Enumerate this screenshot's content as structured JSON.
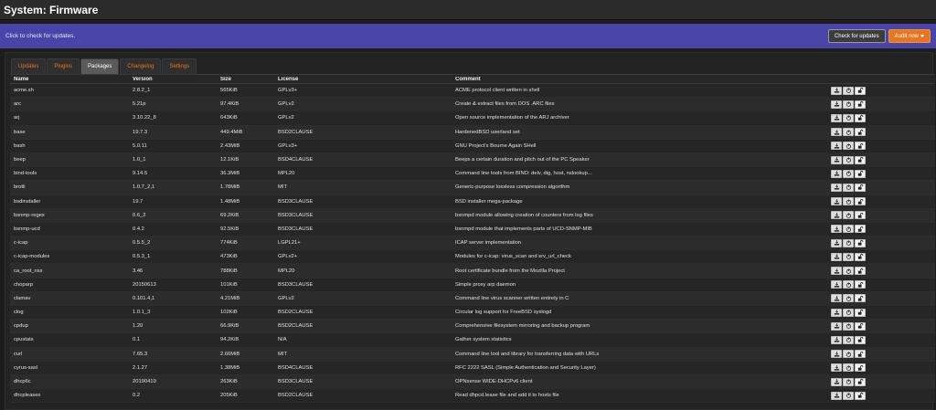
{
  "header": {
    "title": "System: Firmware"
  },
  "banner": {
    "message": "Click to check for updates.",
    "check_label": "Check for updates",
    "audit_label": "Audit now"
  },
  "tabs": [
    {
      "label": "Updates",
      "active": false
    },
    {
      "label": "Plugins",
      "active": false
    },
    {
      "label": "Packages",
      "active": true
    },
    {
      "label": "Changelog",
      "active": false
    },
    {
      "label": "Settings",
      "active": false
    }
  ],
  "table": {
    "columns": [
      "Name",
      "Version",
      "Size",
      "License",
      "Comment"
    ],
    "rows": [
      {
        "name": "acme.sh",
        "version": "2.8.2_1",
        "size": "565KiB",
        "license": "GPLv3+",
        "comment": "ACME protocol client written in shell"
      },
      {
        "name": "arc",
        "version": "5.21p",
        "size": "97.4KiB",
        "license": "GPLv2",
        "comment": "Create & extract files from DOS .ARC files"
      },
      {
        "name": "arj",
        "version": "3.10.22_8",
        "size": "643KiB",
        "license": "GPLv2",
        "comment": "Open source implementation of the ARJ archiver"
      },
      {
        "name": "base",
        "version": "19.7.3",
        "size": "449.4MiB",
        "license": "BSD2CLAUSE",
        "comment": "HardenedBSD userland set"
      },
      {
        "name": "bash",
        "version": "5.0.11",
        "size": "2.43MiB",
        "license": "GPLv3+",
        "comment": "GNU Project's Bourne Again SHell"
      },
      {
        "name": "beep",
        "version": "1.0_1",
        "size": "12.1KiB",
        "license": "BSD4CLAUSE",
        "comment": "Beeps a certain duration and pitch out of the PC Speaker"
      },
      {
        "name": "bind-tools",
        "version": "9.14.5",
        "size": "36.3MiB",
        "license": "MPL20",
        "comment": "Command line tools from BIND: delv, dig, host, nslookup..."
      },
      {
        "name": "brotli",
        "version": "1.0.7_2,1",
        "size": "1.78MiB",
        "license": "MIT",
        "comment": "Generic-purpose lossless compression algorithm"
      },
      {
        "name": "bsdinstaller",
        "version": "19.7",
        "size": "1.48MiB",
        "license": "BSD3CLAUSE",
        "comment": "BSD installer mega-package"
      },
      {
        "name": "bsnmp-regex",
        "version": "0.6_2",
        "size": "69.2KiB",
        "license": "BSD3CLAUSE",
        "comment": "bsnmpd module allowing creation of counters from log files"
      },
      {
        "name": "bsnmp-ucd",
        "version": "0.4.2",
        "size": "92.5KiB",
        "license": "BSD3CLAUSE",
        "comment": "bsnmpd module that implements parts of UCD-SNMP-MIB"
      },
      {
        "name": "c-icap",
        "version": "0.5.5_2",
        "size": "774KiB",
        "license": "LGPL21+",
        "comment": "ICAP server implementation"
      },
      {
        "name": "c-icap-modules",
        "version": "0.5.3_1",
        "size": "473KiB",
        "license": "GPLv2+",
        "comment": "Modules for c-icap: virus_scan and srv_url_check"
      },
      {
        "name": "ca_root_nss",
        "version": "3.46",
        "size": "788KiB",
        "license": "MPL20",
        "comment": "Root certificate bundle from the Mozilla Project"
      },
      {
        "name": "choparp",
        "version": "20150613",
        "size": "101KiB",
        "license": "BSD3CLAUSE",
        "comment": "Simple proxy arp daemon"
      },
      {
        "name": "clamav",
        "version": "0.101.4,1",
        "size": "4.21MiB",
        "license": "GPLv2",
        "comment": "Command line virus scanner written entirely in C"
      },
      {
        "name": "clog",
        "version": "1.0.1_3",
        "size": "102KiB",
        "license": "BSD2CLAUSE",
        "comment": "Circular log support for FreeBSD syslogd"
      },
      {
        "name": "cpdup",
        "version": "1.20",
        "size": "66.9KiB",
        "license": "BSD2CLAUSE",
        "comment": "Comprehensive filesystem mirroring and backup program"
      },
      {
        "name": "cpustats",
        "version": "0.1",
        "size": "94.2KiB",
        "license": "N/A",
        "comment": "Gather system statistics"
      },
      {
        "name": "curl",
        "version": "7.65.3",
        "size": "2.66MiB",
        "license": "MIT",
        "comment": "Command line tool and library for transferring data with URLs"
      },
      {
        "name": "cyrus-sasl",
        "version": "2.1.27",
        "size": "1.38MiB",
        "license": "BSD4CLAUSE",
        "comment": "RFC 2222 SASL (Simple Authentication and Security Layer)"
      },
      {
        "name": "dhcp6c",
        "version": "20190419",
        "size": "263KiB",
        "license": "BSD3CLAUSE",
        "comment": "OPNsense WIDE-DHCPv6 client"
      },
      {
        "name": "dhcpleases",
        "version": "0.2",
        "size": "205KiB",
        "license": "BSD2CLAUSE",
        "comment": "Read dhpcd.lease file and add it to hosts file"
      }
    ]
  },
  "icons": {
    "reinstall": "download-icon",
    "remove": "power-icon",
    "lock": "unlock-icon"
  },
  "colors": {
    "banner": "#4945a8",
    "accent": "#e8761f",
    "active_tab": "#5a5a5a"
  }
}
